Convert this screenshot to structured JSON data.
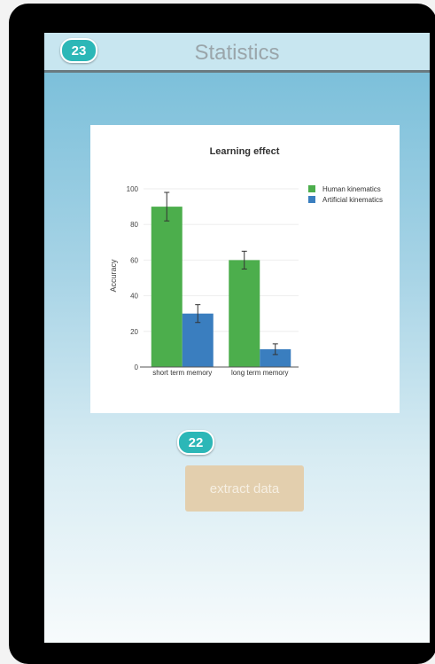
{
  "header": {
    "title": "Statistics",
    "badge": "23"
  },
  "action": {
    "badge": "22",
    "button_label": "extract data"
  },
  "colors": {
    "human": "#4cae4c",
    "artificial": "#3a7ebf",
    "badge": "#2cb7b7",
    "button": "#e3cfae"
  },
  "chart_data": {
    "type": "bar",
    "title": "Learning effect",
    "ylabel": "Accuracy",
    "xlabel": "",
    "ylim": [
      0,
      100
    ],
    "yticks": [
      0,
      20,
      40,
      60,
      80,
      100
    ],
    "categories": [
      "short term memory",
      "long term memory"
    ],
    "series": [
      {
        "name": "Human kinematics",
        "values": [
          90,
          60
        ],
        "errors": [
          8,
          5
        ]
      },
      {
        "name": "Artificial kinematics",
        "values": [
          30,
          10
        ],
        "errors": [
          5,
          3
        ]
      }
    ],
    "legend_position": "top-right",
    "grid": true
  }
}
